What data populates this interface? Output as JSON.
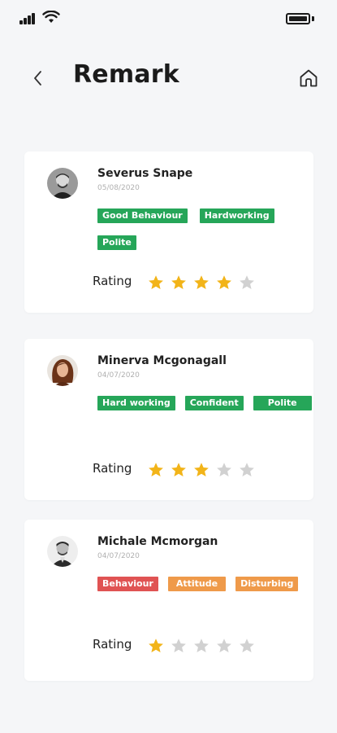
{
  "header": {
    "title": "Remark"
  },
  "colors": {
    "green": "#26a659",
    "red": "#e05353",
    "orange": "#ef9a4a",
    "star_filled": "#f2b419",
    "star_empty": "#d1d1d1"
  },
  "remarks": [
    {
      "name": "Severus Snape",
      "date": "05/08/2020",
      "tags": [
        {
          "label": "Good Behaviour",
          "color": "#26a659"
        },
        {
          "label": "Hardworking",
          "color": "#26a659"
        },
        {
          "label": "Polite",
          "color": "#26a659"
        }
      ],
      "rating_label": "Rating",
      "rating": 4,
      "rating_max": 5
    },
    {
      "name": "Minerva Mcgonagall",
      "date": "04/07/2020",
      "tags": [
        {
          "label": "Hard working",
          "color": "#26a659"
        },
        {
          "label": "Confident",
          "color": "#26a659"
        },
        {
          "label": "Polite",
          "color": "#26a659"
        }
      ],
      "rating_label": "Rating",
      "rating": 3,
      "rating_max": 5
    },
    {
      "name": "Michale Mcmorgan",
      "date": "04/07/2020",
      "tags": [
        {
          "label": "Behaviour",
          "color": "#e05353"
        },
        {
          "label": "Attitude",
          "color": "#ef9a4a"
        },
        {
          "label": "Disturbing",
          "color": "#ef9a4a"
        }
      ],
      "rating_label": "Rating",
      "rating": 1,
      "rating_max": 5
    }
  ]
}
